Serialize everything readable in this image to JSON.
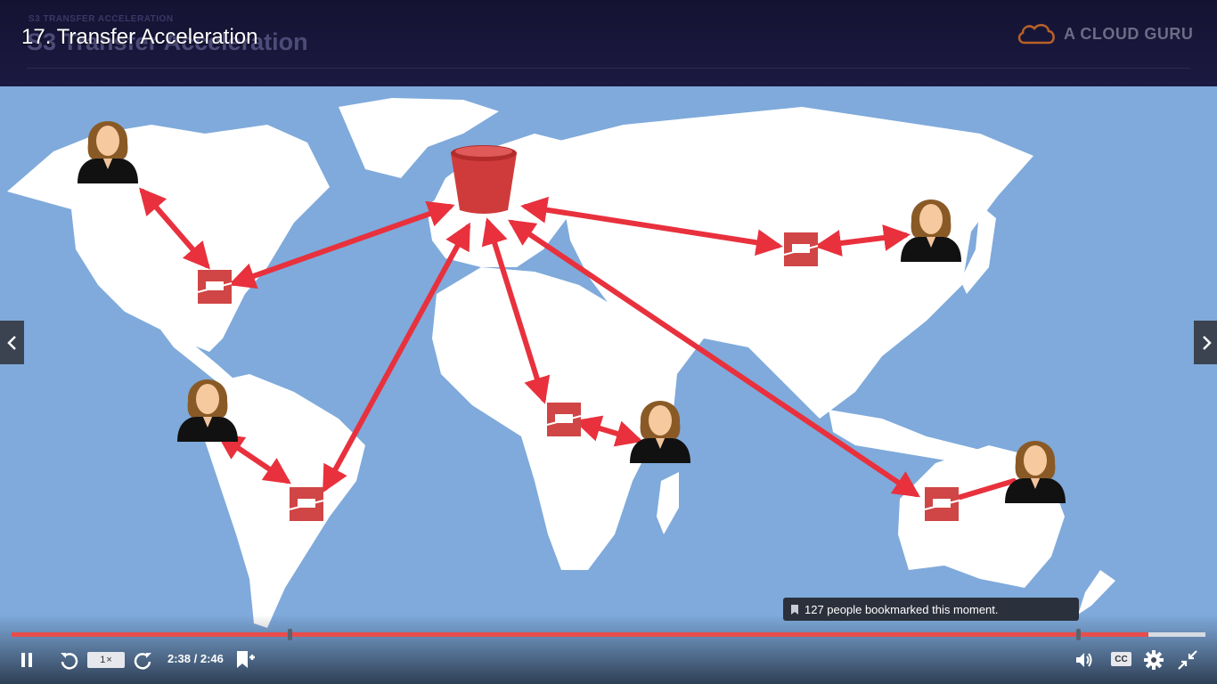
{
  "player": {
    "title": "17. Transfer Acceleration"
  },
  "slide": {
    "kicker": "S3 TRANSFER ACCELERATION",
    "heading": "S3 Transfer Acceleration",
    "brand": "A CLOUD GURU"
  },
  "tooltip": {
    "text": "127 people bookmarked this moment."
  },
  "controls": {
    "speed_value": "1",
    "speed_unit": "×",
    "time_current": "2:38",
    "time_separator": " / ",
    "time_total": "2:46",
    "cc_label": "CC",
    "progress_fraction": 0.952
  },
  "colors": {
    "accent": "#e84c4c",
    "map_water": "#7faadb",
    "map_land": "#ffffff",
    "arrow": "#e8313d",
    "edge_box": "#d04545"
  },
  "icons": [
    "pause-icon",
    "rewind-icon",
    "forward-icon",
    "bookmark-add-icon",
    "volume-icon",
    "settings-icon",
    "exit-fullscreen-icon",
    "chevron-left-icon",
    "chevron-right-icon",
    "bookmark-icon",
    "cloud-logo-icon",
    "s3-bucket-icon",
    "user-icon",
    "edge-location-icon"
  ]
}
